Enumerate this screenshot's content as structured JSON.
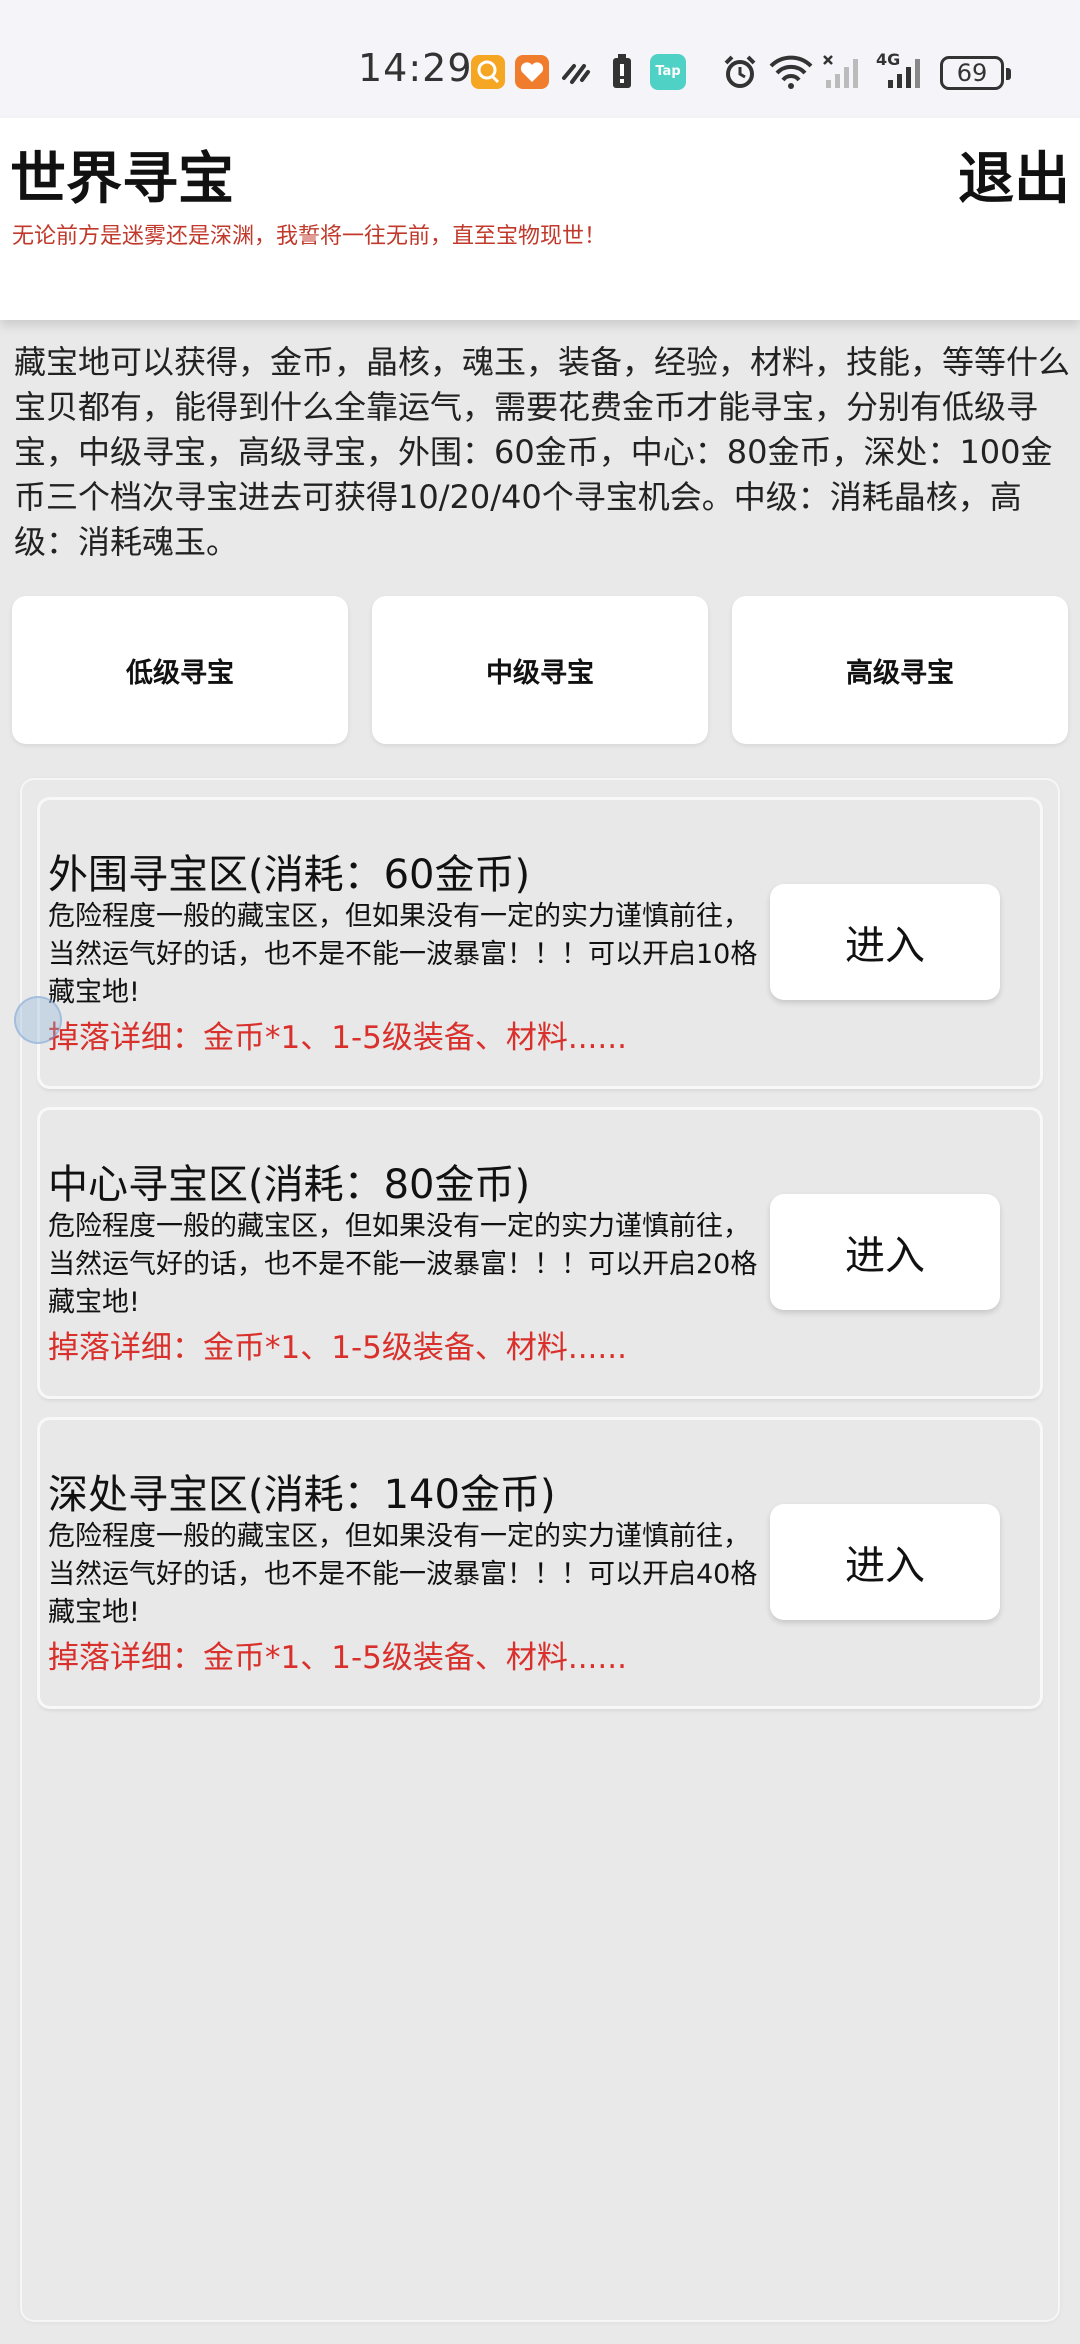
{
  "status_bar": {
    "time": "14:29",
    "battery": "69",
    "network": "4G",
    "tap_label": "Tap",
    "icons": [
      "search-app-icon",
      "heart-app-icon",
      "link-icon",
      "battery-alert-icon",
      "tap-app-icon",
      "alarm-icon",
      "wifi-icon",
      "signal-off-icon",
      "signal-4g-icon"
    ]
  },
  "header": {
    "title": "世界寻宝",
    "exit_label": "退出",
    "subtitle": "无论前方是迷雾还是深渊，我誓将一往无前，直至宝物现世！"
  },
  "description": "藏宝地可以获得，金币，晶核，魂玉，装备，经验，材料，技能，等等什么宝贝都有，能得到什么全靠运气，需要花费金币才能寻宝，分别有低级寻宝，中级寻宝，高级寻宝，外围：60金币，中心：80金币，深处：100金币三个档次寻宝进去可获得10/20/40个寻宝机会。中级：消耗晶核，高级：消耗魂玉。",
  "tiers": [
    {
      "label": "低级寻宝"
    },
    {
      "label": "中级寻宝"
    },
    {
      "label": "高级寻宝"
    }
  ],
  "zones": [
    {
      "title": "外围寻宝区(消耗：60金币)",
      "desc": "危险程度一般的藏宝区，但如果没有一定的实力谨慎前往，当然运气好的话，也不是不能一波暴富！！！可以开启10格藏宝地!",
      "drops": "掉落详细：金币*1、1-5级装备、材料......",
      "enter_label": "进入"
    },
    {
      "title": "中心寻宝区(消耗：80金币)",
      "desc": "危险程度一般的藏宝区，但如果没有一定的实力谨慎前往，当然运气好的话，也不是不能一波暴富！！！可以开启20格藏宝地!",
      "drops": "掉落详细：金币*1、1-5级装备、材料......",
      "enter_label": "进入"
    },
    {
      "title": "深处寻宝区(消耗：140金币)",
      "desc": "危险程度一般的藏宝区，但如果没有一定的实力谨慎前往，当然运气好的话，也不是不能一波暴富！！！可以开启40格藏宝地!",
      "drops": "掉落详细：金币*1、1-5级装备、材料......",
      "enter_label": "进入"
    }
  ],
  "colors": {
    "accent_red": "#d9302c",
    "subtitle_red": "#c0392b",
    "background": "#e9e9e9"
  }
}
